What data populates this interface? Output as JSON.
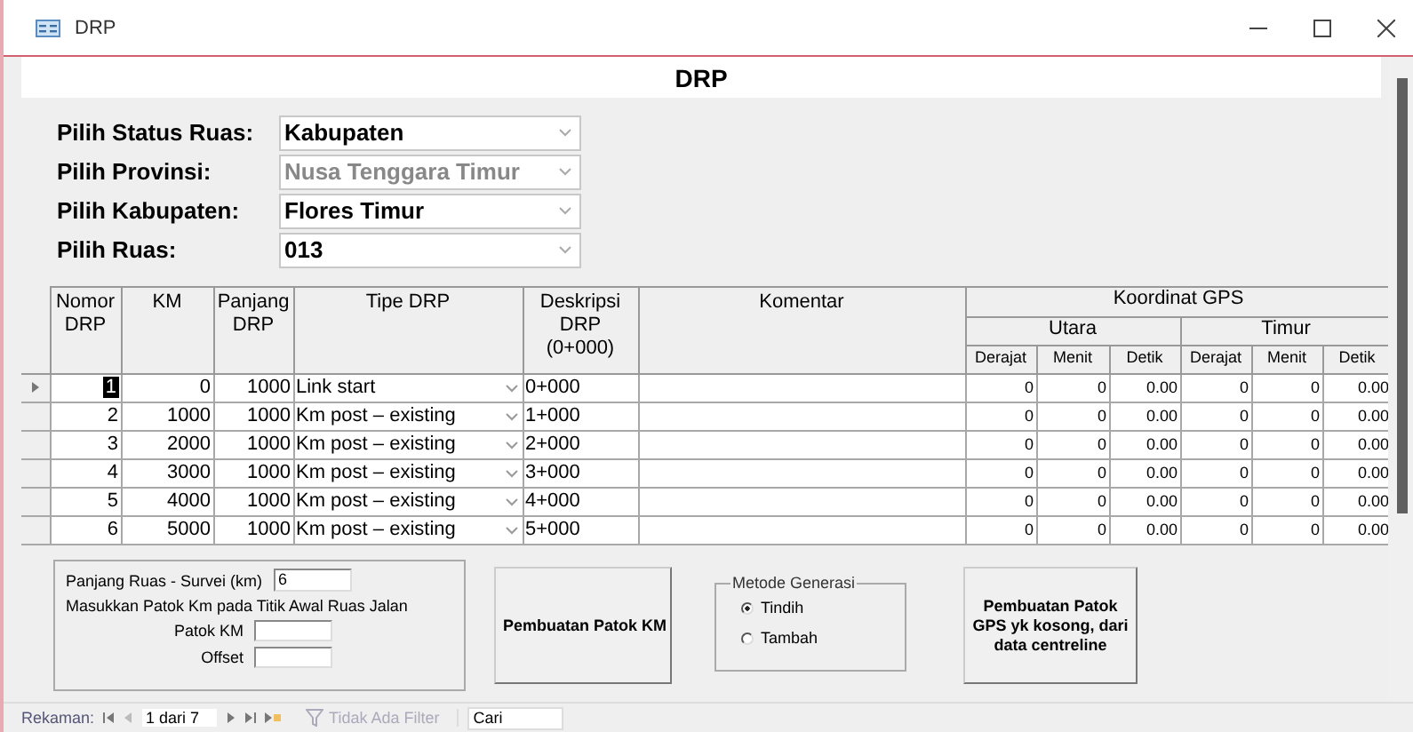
{
  "window": {
    "title": "DRP"
  },
  "form_title": "DRP",
  "filters": [
    {
      "label": "Pilih Status Ruas:",
      "value": "Kabupaten",
      "disabled": false
    },
    {
      "label": "Pilih Provinsi:",
      "value": "Nusa Tenggara Timur",
      "disabled": true
    },
    {
      "label": "Pilih Kabupaten:",
      "value": "Flores Timur",
      "disabled": false
    },
    {
      "label": "Pilih Ruas:",
      "value": "013",
      "disabled": false
    }
  ],
  "table": {
    "columns": [
      "Nomor DRP",
      "KM",
      "Panjang DRP",
      "Tipe DRP",
      "Deskripsi DRP (0+000)",
      "Komentar"
    ],
    "gps_heading": "Koordinat GPS",
    "groups": [
      "Utara",
      "Timur"
    ],
    "subcolumns": [
      "Derajat",
      "Menit",
      "Detik",
      "Derajat",
      "Menit",
      "Detik"
    ],
    "rows": [
      {
        "selected": true,
        "cells": [
          "1",
          "0",
          "1000",
          "Link start",
          "0+000"
        ],
        "gps": [
          "0",
          "0",
          "0.00",
          "0",
          "0",
          "0.00"
        ]
      },
      {
        "selected": false,
        "cells": [
          "2",
          "1000",
          "1000",
          "Km post – existing",
          "1+000"
        ],
        "gps": [
          "0",
          "0",
          "0.00",
          "0",
          "0",
          "0.00"
        ]
      },
      {
        "selected": false,
        "cells": [
          "3",
          "2000",
          "1000",
          "Km post – existing",
          "2+000"
        ],
        "gps": [
          "0",
          "0",
          "0.00",
          "0",
          "0",
          "0.00"
        ]
      },
      {
        "selected": false,
        "cells": [
          "4",
          "3000",
          "1000",
          "Km post – existing",
          "3+000"
        ],
        "gps": [
          "0",
          "0",
          "0.00",
          "0",
          "0",
          "0.00"
        ]
      },
      {
        "selected": false,
        "cells": [
          "5",
          "4000",
          "1000",
          "Km post – existing",
          "4+000"
        ],
        "gps": [
          "0",
          "0",
          "0.00",
          "0",
          "0",
          "0.00"
        ]
      },
      {
        "selected": false,
        "cells": [
          "6",
          "5000",
          "1000",
          "Km post – existing",
          "5+000"
        ],
        "gps": [
          "0",
          "0",
          "0.00",
          "0",
          "0",
          "0.00"
        ]
      }
    ]
  },
  "survey": {
    "length_label": "Panjang Ruas - Survei (km)",
    "length_value": "6",
    "instruction": "Masukkan Patok Km pada Titik Awal Ruas Jalan",
    "patok_label": "Patok KM",
    "offset_label": "Offset"
  },
  "generate_button": "Pembuatan Patok KM",
  "method": {
    "title": "Metode Generasi",
    "options": [
      {
        "label": "Tindih",
        "selected": true
      },
      {
        "label": "Tambah",
        "selected": false
      }
    ]
  },
  "gps_button": "Pembuatan Patok GPS yk kosong, dari data centreline",
  "status_bar": {
    "label": "Rekaman:",
    "position": "1 dari 7",
    "filter": "Tidak Ada Filter",
    "filter_disabled": true,
    "search_value": "Cari"
  }
}
